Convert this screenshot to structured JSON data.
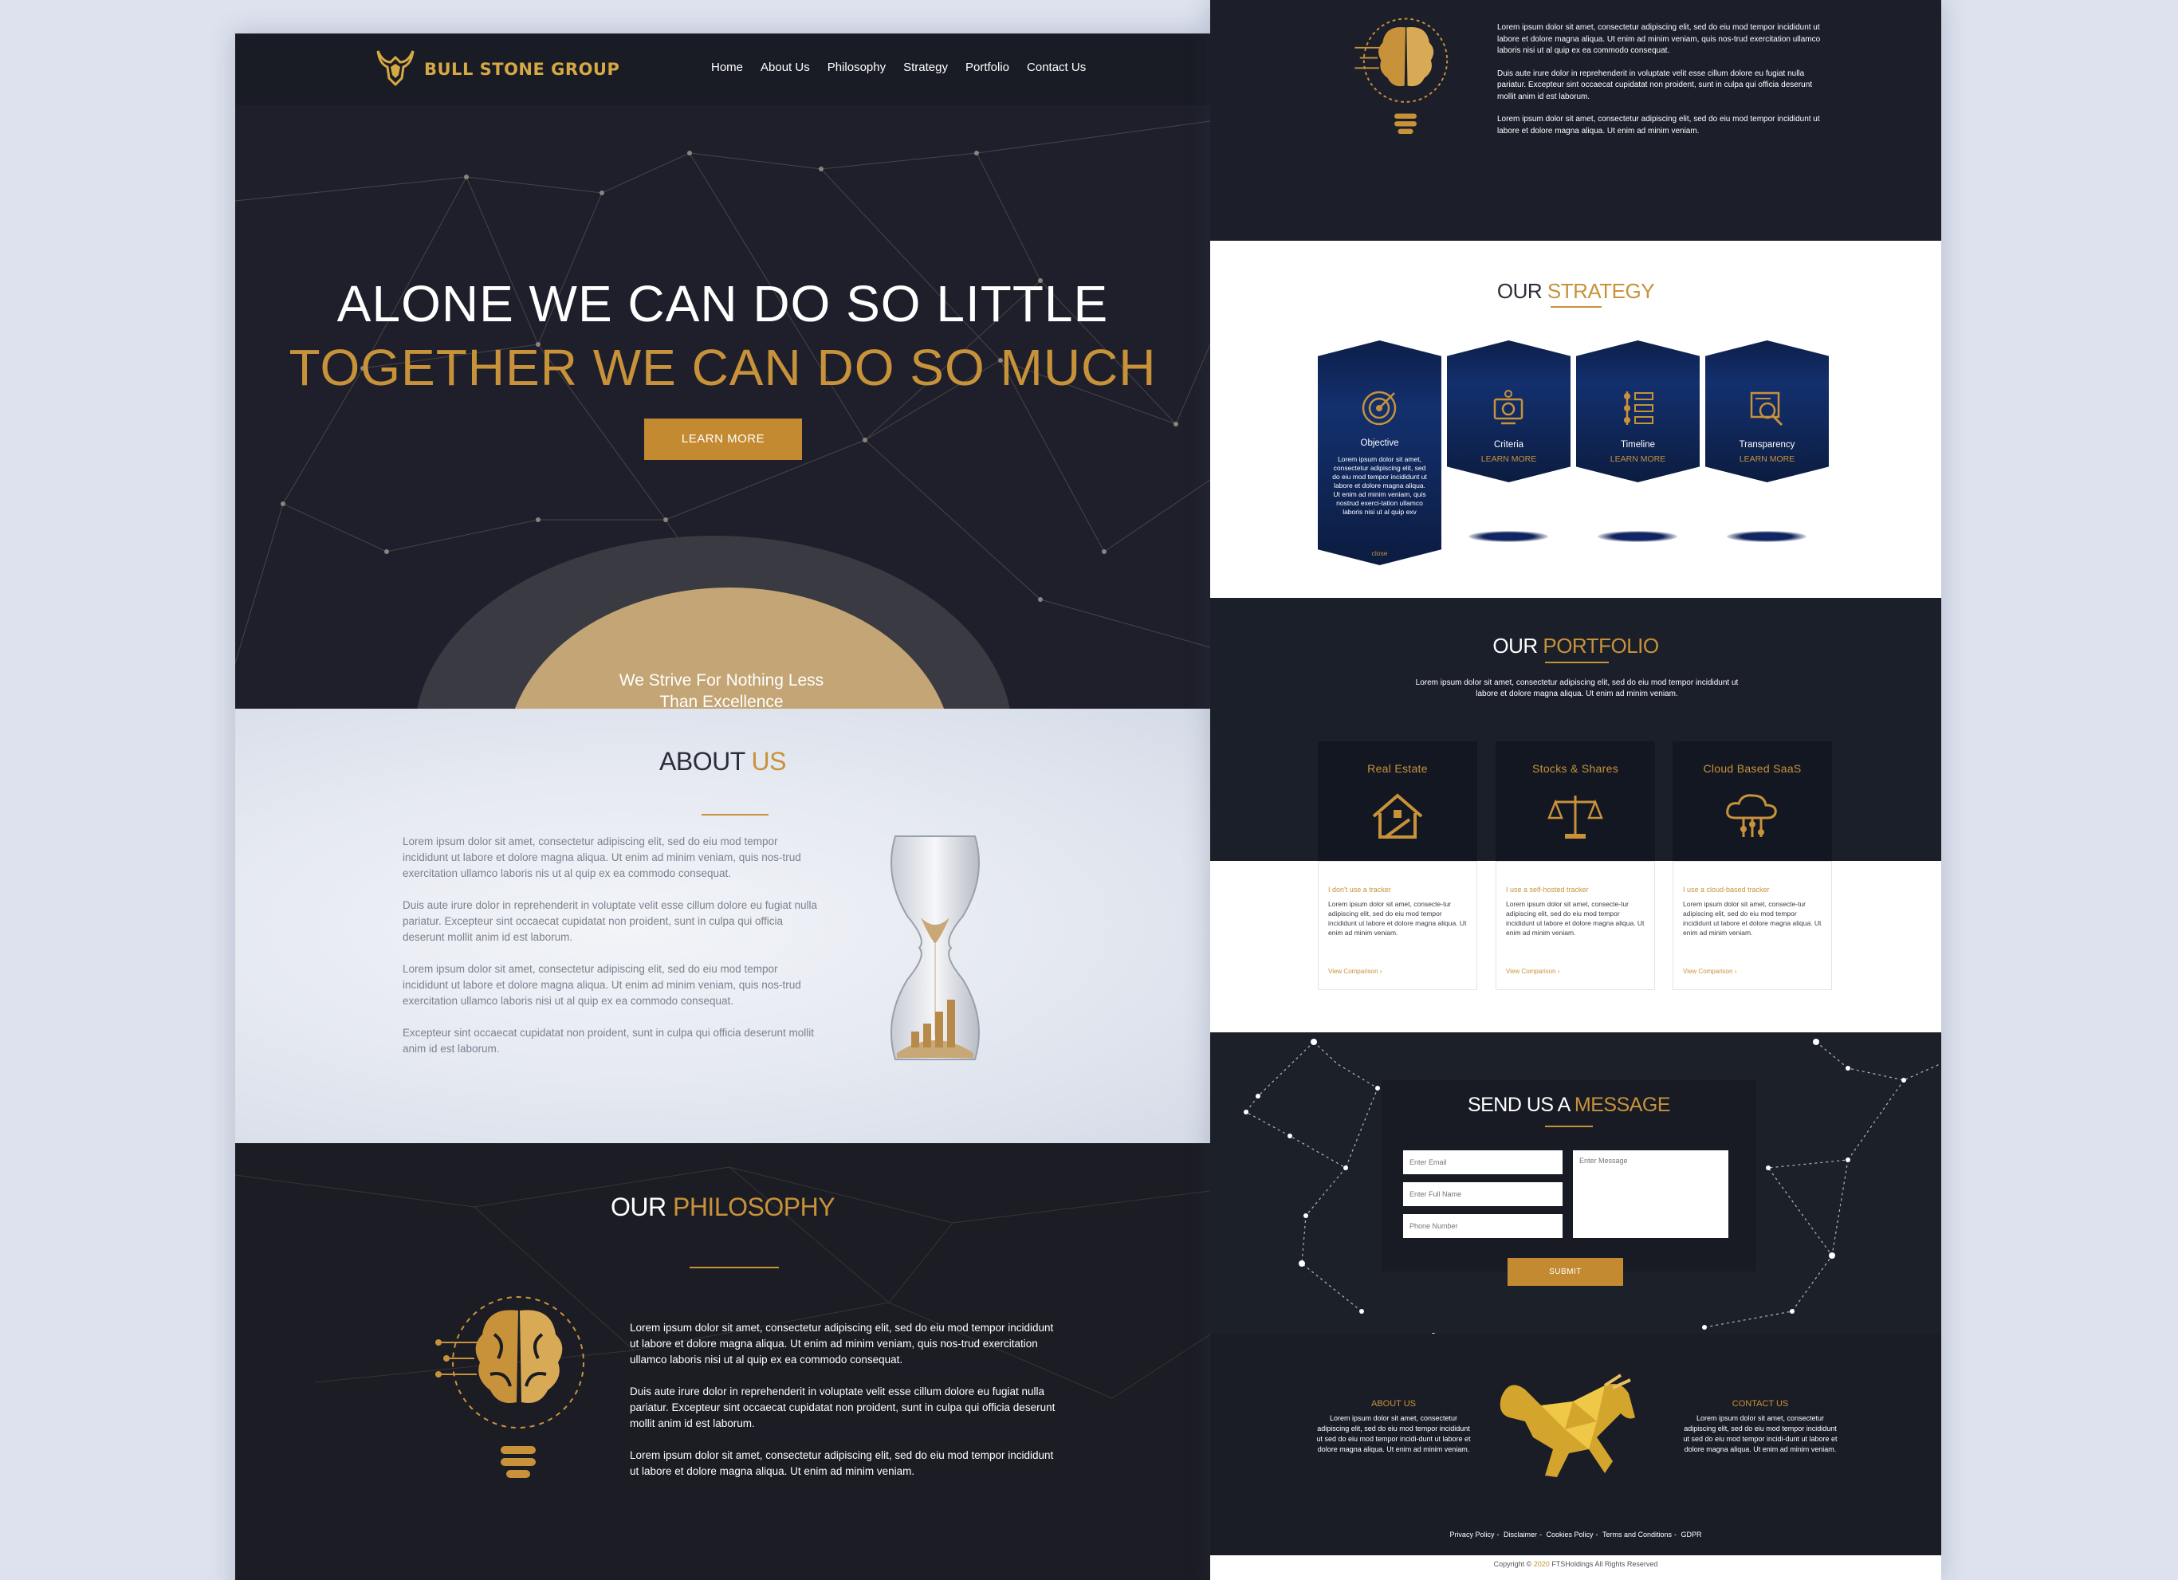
{
  "brand": {
    "logo_text": "BULL STONE GROUP"
  },
  "nav": {
    "items": [
      "Home",
      "About Us",
      "Philosophy",
      "Strategy",
      "Portfolio",
      "Contact Us"
    ]
  },
  "hero": {
    "line1": "ALONE WE CAN DO SO LITTLE",
    "line2": "TOGETHER WE CAN DO SO MUCH",
    "button": "LEARN MORE",
    "tagline_1": "We Strive For Nothing Less",
    "tagline_2": "Than Excellence"
  },
  "about": {
    "title_a": "ABOUT ",
    "title_b": "US",
    "paragraphs": [
      "Lorem ipsum dolor sit amet, consectetur adipiscing elit, sed do eiu mod tempor incididunt ut labore et dolore magna aliqua. Ut enim ad minim veniam, quis nos-trud exercitation ullamco laboris nis ut al quip ex ea commodo consequat.",
      "Duis aute irure dolor in reprehenderit in voluptate velit esse cillum dolore eu fugiat nulla pariatur. Excepteur sint occaecat cupidatat non proident, sunt in culpa qui officia deserunt mollit anim id est laborum.",
      "Lorem ipsum dolor sit amet, consectetur adipiscing elit, sed do eiu mod tempor incididunt ut labore et dolore magna aliqua. Ut enim ad minim veniam, quis nos-trud exercitation ullamco laboris nisi ut al quip ex ea commodo consequat.",
      "Excepteur sint occaecat cupidatat non proident, sunt in culpa qui officia deserunt mollit anim id est laborum."
    ]
  },
  "philosophy": {
    "title_a": "OUR ",
    "title_b": "PHILOSOPHY",
    "paragraphs": [
      "Lorem ipsum dolor sit amet, consectetur adipiscing elit, sed do eiu mod tempor incididunt ut labore et dolore magna aliqua. Ut enim ad minim veniam, quis nos-trud exercitation ullamco laboris nisi ut al quip ex ea commodo consequat.",
      "Duis aute irure dolor in reprehenderit in voluptate velit esse cillum dolore eu fugiat nulla pariatur. Excepteur sint occaecat cupidatat non proident, sunt in culpa qui officia deserunt mollit anim id est laborum.",
      "Lorem ipsum dolor sit amet, consectetur adipiscing elit, sed do eiu mod tempor incididunt ut labore et dolore magna aliqua. Ut enim ad minim veniam."
    ]
  },
  "strategy": {
    "title_a": "OUR ",
    "title_b": "STRATEGY",
    "items": [
      {
        "label": "Objective",
        "desc": "Lorem ipsum dolor sit amet, consectetur adipiscing elit, sed do eiu mod tempor incididunt ut labore et dolore magna aliqua. Ut enim ad minim veniam, quis nostrud exerci-tation ullamco laboris nisi ut al quip exv",
        "close": "close"
      },
      {
        "label": "Criteria",
        "more": "LEARN MORE"
      },
      {
        "label": "Timeline",
        "more": "LEARN MORE"
      },
      {
        "label": "Transparency",
        "more": "LEARN MORE"
      }
    ]
  },
  "portfolio": {
    "title_a": "OUR ",
    "title_b": "PORTFOLIO",
    "subtitle": "Lorem ipsum dolor sit amet, consectetur adipiscing elit, sed do eiu mod tempor incididunt ut labore et dolore magna aliqua. Ut enim ad minim veniam.",
    "cards": [
      {
        "title": "Real Estate",
        "sub": "I don't use a tracker",
        "desc": "Lorem ipsum dolor sit amet, consecte-tur adipiscing elit, sed do eiu mod tempor incididunt ut labore et dolore magna aliqua. Ut enim ad minim veniam.",
        "link": "View Comparison  ›"
      },
      {
        "title": "Stocks & Shares",
        "sub": "I use a self-hosted tracker",
        "desc": "Lorem ipsum dolor sit amet, consecte-tur adipiscing elit, sed do eiu mod tempor incididunt ut labore et dolore magna aliqua. Ut enim ad minim veniam.",
        "link": "View Comparison  ›"
      },
      {
        "title": "Cloud Based SaaS",
        "sub": "I use a cloud-based tracker",
        "desc": "Lorem ipsum dolor sit amet, consecte-tur adipiscing elit, sed do eiu mod tempor incididunt ut labore et dolore magna aliqua. Ut enim ad minim veniam.",
        "link": "View Comparison  ›"
      }
    ]
  },
  "contact": {
    "title_a": "SEND US A ",
    "title_b": "MESSAGE",
    "email_placeholder": "Enter Email",
    "name_placeholder": "Enter Full Name",
    "phone_placeholder": "Phone Number",
    "message_placeholder": "Enter Message",
    "submit": "SUBMIT"
  },
  "footer": {
    "about_title": "ABOUT US",
    "about_text": "Lorem ipsum dolor sit amet, consectetur adipiscing elit, sed do eiu mod tempor incididunt ut sed do eiu mod tempor incidi-dunt ut labore et dolore magna aliqua. Ut enim ad minim veniam.",
    "contact_title": "CONTACT US",
    "contact_text": "Lorem ipsum dolor sit amet, consectetur adipiscing elit, sed do eiu mod tempor incididunt ut sed do eiu mod tempor incidi-dunt ut labore et dolore magna aliqua. Ut enim ad minim veniam.",
    "links": [
      "Privacy Policy",
      "Disclaimer",
      "Cookies Policy",
      "Terms and Conditions",
      "GDPR"
    ],
    "copyright_a": "Copyright © ",
    "copyright_year": "2020",
    "copyright_b": " FTSHoldings All Rights Reserved"
  },
  "colors": {
    "gold": "#c8923a",
    "navy": "#1b1c26",
    "hex_blue": "#13306e"
  }
}
